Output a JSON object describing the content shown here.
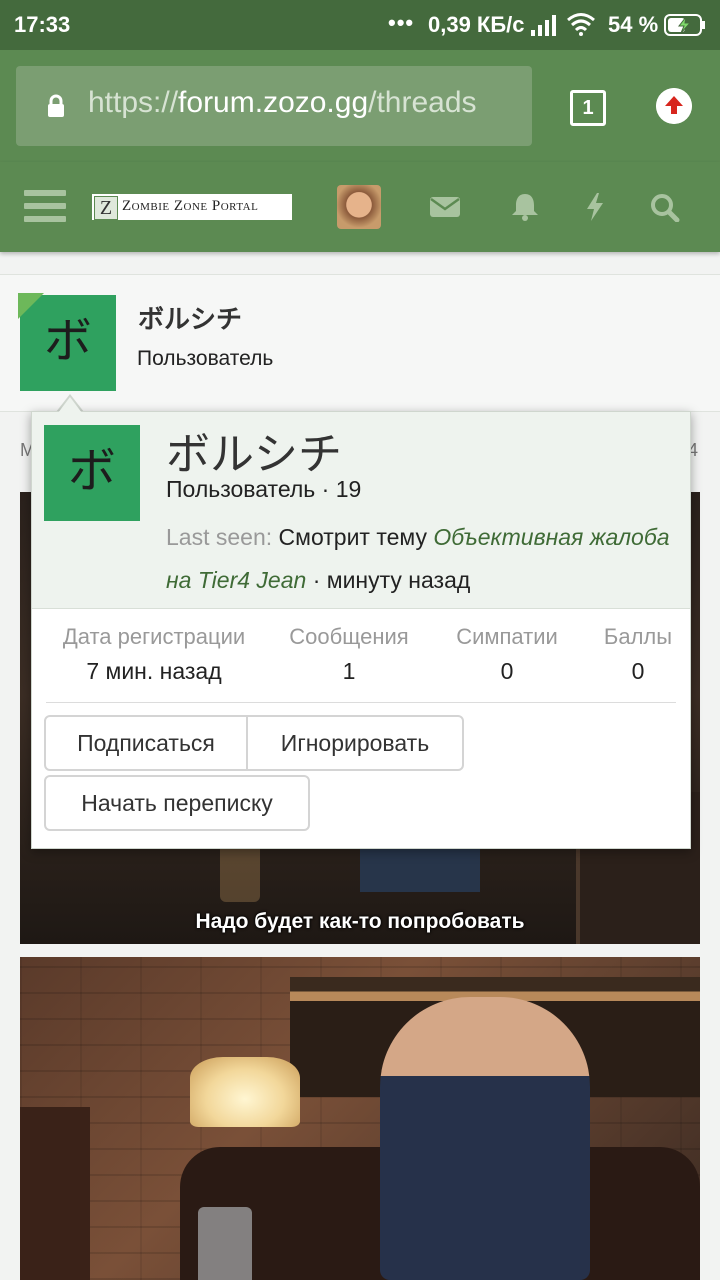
{
  "status_bar": {
    "time": "17:33",
    "dots": "•••",
    "network_speed": "0,39 КБ/с",
    "battery_percent": "54 %"
  },
  "browser": {
    "url_scheme": "https://",
    "url_host": "forum.zozo.gg",
    "url_path": "/threads",
    "tab_count": "1"
  },
  "forum_nav": {
    "logo_letter": "Z",
    "logo_text": "Zombie Zone Portal",
    "icons": [
      "menu-icon",
      "envelope-icon",
      "bell-icon",
      "bolt-icon",
      "search-icon"
    ]
  },
  "user_card": {
    "avatar_letter": "ボ",
    "username": "ボルシチ",
    "role": "Пользователь"
  },
  "background_post": {
    "peek_left": "М",
    "peek_right": "4",
    "subtitle": "Надо будет как-то попробовать"
  },
  "popup": {
    "avatar_letter": "ボ",
    "username": "ボルシチ",
    "role_line": "Пользователь · 19",
    "last_seen_label": "Last seen:",
    "last_seen_action": "Смотрит тему",
    "last_seen_thread": "Объективная жалоба на Tier4 Jean",
    "last_seen_time": "· минуту назад",
    "stats": [
      {
        "label": "Дата регистрации",
        "value": "7 мин. назад"
      },
      {
        "label": "Сообщения",
        "value": "1"
      },
      {
        "label": "Симпатии",
        "value": "0"
      },
      {
        "label": "Баллы",
        "value": "0"
      }
    ],
    "buttons": {
      "follow": "Подписаться",
      "ignore": "Игнорировать",
      "message": "Начать переписку"
    }
  },
  "colors": {
    "statusbar": "#446a3d",
    "toolbar": "#5c8a52",
    "avatar": "#2fa15f",
    "link": "#3f6b36"
  }
}
